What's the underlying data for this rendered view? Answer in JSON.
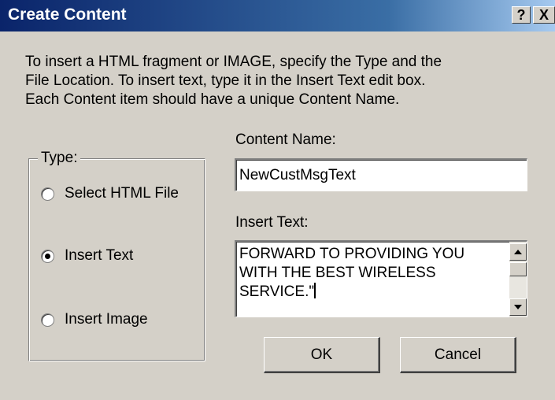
{
  "window": {
    "title": "Create Content",
    "help_glyph": "?",
    "close_glyph": "X"
  },
  "description": {
    "lines": [
      "To insert a HTML fragment or IMAGE, specify the Type and the",
      "File Location. To insert text, type it in the Insert Text edit box.",
      "Each Content item should have a unique Content Name."
    ]
  },
  "type_group": {
    "legend": "Type:",
    "options": [
      {
        "label": "Select HTML File",
        "selected": false
      },
      {
        "label": "Insert Text",
        "selected": true
      },
      {
        "label": "Insert Image",
        "selected": false
      }
    ]
  },
  "content_name": {
    "label": "Content Name:",
    "value": "NewCustMsgText"
  },
  "insert_text": {
    "label": "Insert Text:",
    "lines": [
      "FORWARD TO PROVIDING YOU",
      "WITH THE BEST WIRELESS",
      "SERVICE.\""
    ]
  },
  "buttons": {
    "ok": "OK",
    "cancel": "Cancel"
  }
}
